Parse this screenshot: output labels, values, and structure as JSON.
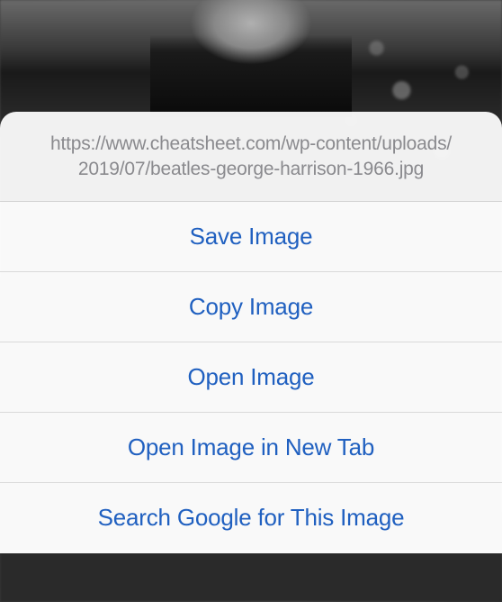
{
  "header": {
    "url_line1": "https://www.cheatsheet.com/wp-content/uploads/",
    "url_line2": "2019/07/beatles-george-harrison-1966.jpg"
  },
  "menu": {
    "save_image": "Save Image",
    "copy_image": "Copy Image",
    "open_image": "Open Image",
    "open_image_new_tab": "Open Image in New Tab",
    "search_google": "Search Google for This Image"
  }
}
